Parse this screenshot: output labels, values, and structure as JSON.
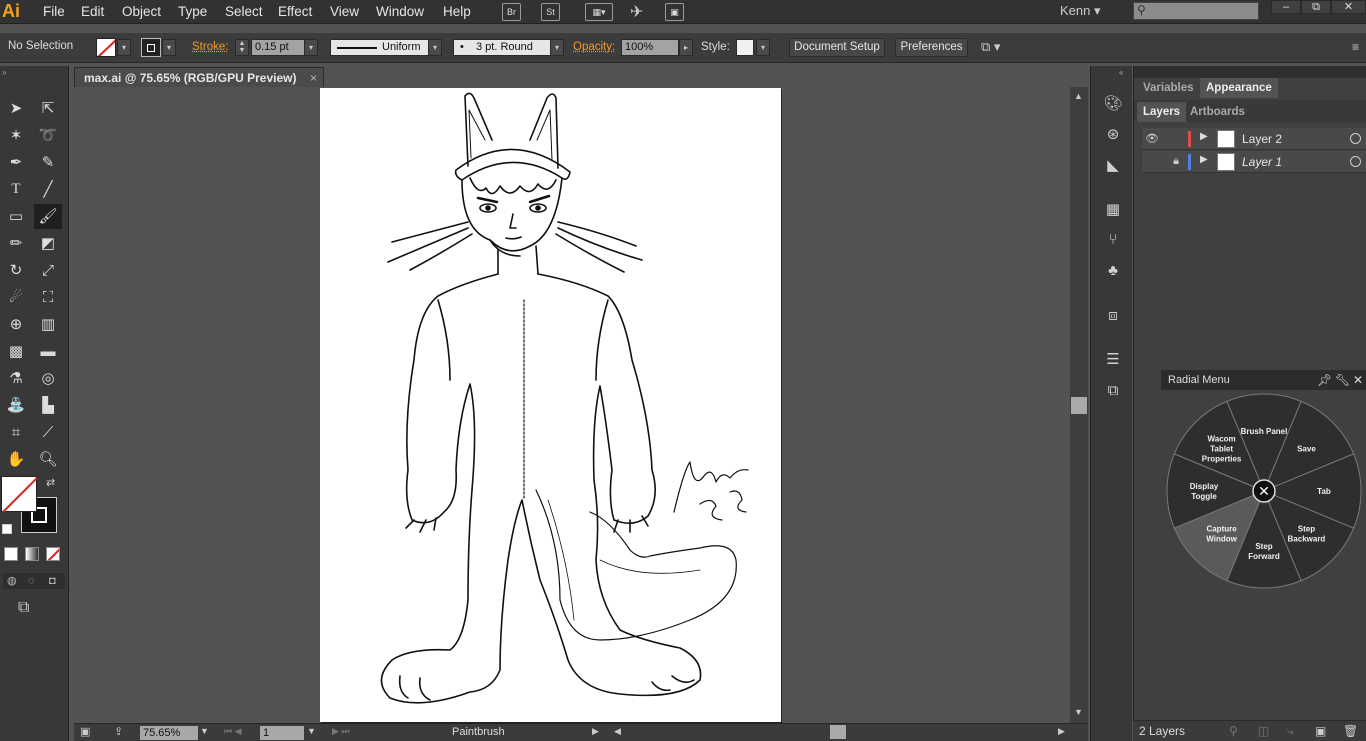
{
  "app": {
    "logo": "Ai",
    "menu": [
      "File",
      "Edit",
      "Object",
      "Type",
      "Select",
      "Effect",
      "View",
      "Window",
      "Help"
    ],
    "bridge_label": "Br",
    "stock_label": "St",
    "user": "Kenn",
    "window_buttons": [
      "–",
      "⧉",
      "✕"
    ]
  },
  "control_bar": {
    "selection_status": "No Selection",
    "stroke_label": "Stroke:",
    "stroke_weight": "0.15 pt",
    "profile": "Uniform",
    "brush": "3 pt. Round",
    "opacity_label": "Opacity:",
    "opacity_value": "100%",
    "style_label": "Style:",
    "document_setup": "Document Setup",
    "preferences": "Preferences"
  },
  "document": {
    "tab_title": "max.ai @ 75.65% (RGB/GPU Preview)",
    "close": "×",
    "signature": "Kenn 295"
  },
  "status_bar": {
    "zoom": "75.65%",
    "artboard_number": "1",
    "current_tool": "Paintbrush"
  },
  "panels": {
    "top_tabs": [
      "Variables",
      "Appearance"
    ],
    "active_top_tab": "Appearance",
    "sub_tabs": [
      "Layers",
      "Artboards"
    ],
    "layers": [
      {
        "name": "Layer 2",
        "color": "#e04b4b",
        "visible": true,
        "locked": false
      },
      {
        "name": "Layer 1",
        "color": "#4f7fe0",
        "visible": false,
        "locked": true
      }
    ],
    "layer_count": "2 Layers"
  },
  "radial_menu": {
    "title": "Radial Menu",
    "items": [
      [
        "Brush Panel"
      ],
      [
        "Save"
      ],
      [
        "Tab"
      ],
      [
        "Step",
        "Backward"
      ],
      [
        "Step",
        "Forward"
      ],
      [
        "Capture",
        "Window"
      ],
      [
        "Display",
        "Toggle"
      ],
      [
        "Wacom",
        "Tablet",
        "Properties"
      ]
    ],
    "highlighted_index": 5
  },
  "colors": {
    "accent_orange": "#f39a2b",
    "menu_bg": "#323232",
    "canvas_bg": "#535353"
  }
}
